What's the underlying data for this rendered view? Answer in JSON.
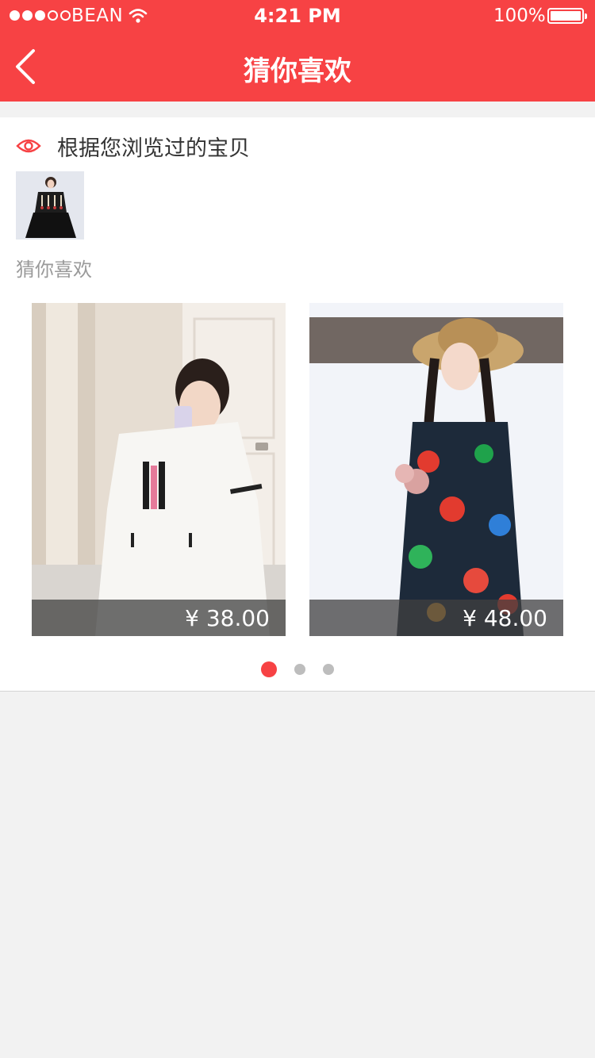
{
  "status_bar": {
    "carrier": "BEAN",
    "time": "4:21 PM",
    "battery": "100%",
    "signal_bars": 3,
    "signal_total": 5
  },
  "nav": {
    "title": "猜你喜欢",
    "back_icon": "chevron-left-icon"
  },
  "section": {
    "title": "根据您浏览过的宝贝",
    "icon": "eye-icon",
    "subtitle": "猜你喜欢"
  },
  "products": [
    {
      "price": "¥ 38.00"
    },
    {
      "price": "¥ 48.00"
    }
  ],
  "pager": {
    "pages": 3,
    "active": 1
  },
  "colors": {
    "accent": "#f74244",
    "background": "#f2f2f2"
  }
}
